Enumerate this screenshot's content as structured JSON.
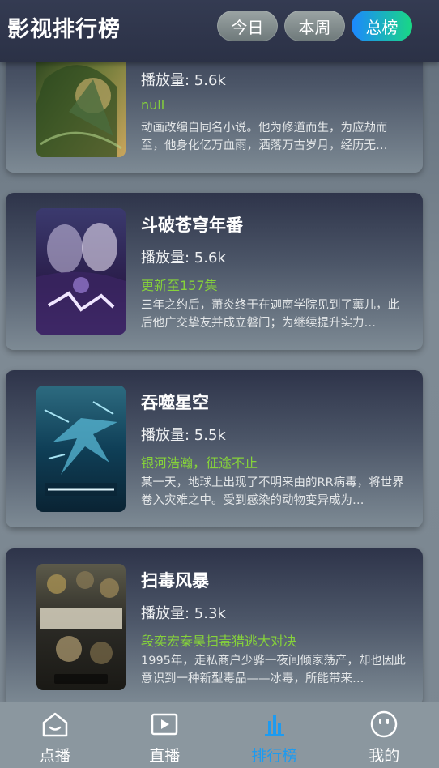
{
  "header": {
    "title": "影视排行榜",
    "tabs": [
      {
        "label": "今日",
        "active": false
      },
      {
        "label": "本周",
        "active": false
      },
      {
        "label": "总榜",
        "active": true
      }
    ]
  },
  "cards": [
    {
      "title": "",
      "plays": "播放量: 5.6k",
      "update": "null",
      "desc": "动画改编自同名小说。他为修道而生，为应劫而至，他身化亿万血雨，洒落万古岁月，经历无…",
      "poster_colors": [
        "#1e3a1a",
        "#c9a55c"
      ]
    },
    {
      "title": "斗破苍穹年番",
      "plays": "播放量: 5.6k",
      "update": "更新至157集",
      "desc": "三年之约后，萧炎终于在迦南学院见到了薰儿，此后他广交挚友并成立磐门；为继续提升实力…",
      "poster_colors": [
        "#2a1d4a",
        "#8d6fc9"
      ]
    },
    {
      "title": "吞噬星空",
      "plays": "播放量: 5.5k",
      "update": "银河浩瀚，征途不止",
      "desc": "某一天，地球上出现了不明来由的RR病毒，将世界卷入灾难之中。受到感染的动物变异成为…",
      "poster_colors": [
        "#0f3f57",
        "#58b8d6"
      ]
    },
    {
      "title": "扫毒风暴",
      "plays": "播放量: 5.3k",
      "update": "段奕宏秦昊扫毒猎逃大对决",
      "desc": "1995年，走私商户少骅一夜间倾家荡产，却也因此意识到一种新型毒品——冰毒，所能带来…",
      "poster_colors": [
        "#2b2a25",
        "#b39a55"
      ]
    }
  ],
  "bottom_nav": [
    {
      "label": "点播",
      "icon": "home-icon",
      "active": false
    },
    {
      "label": "直播",
      "icon": "play-icon",
      "active": false
    },
    {
      "label": "排行榜",
      "icon": "bar-chart-icon",
      "active": true
    },
    {
      "label": "我的",
      "icon": "smile-icon",
      "active": false
    }
  ],
  "colors": {
    "accent_blue": "#1e9bf0",
    "update_green": "#86d33a",
    "tab_gradient": [
      "#1c87ff",
      "#19d884"
    ]
  }
}
